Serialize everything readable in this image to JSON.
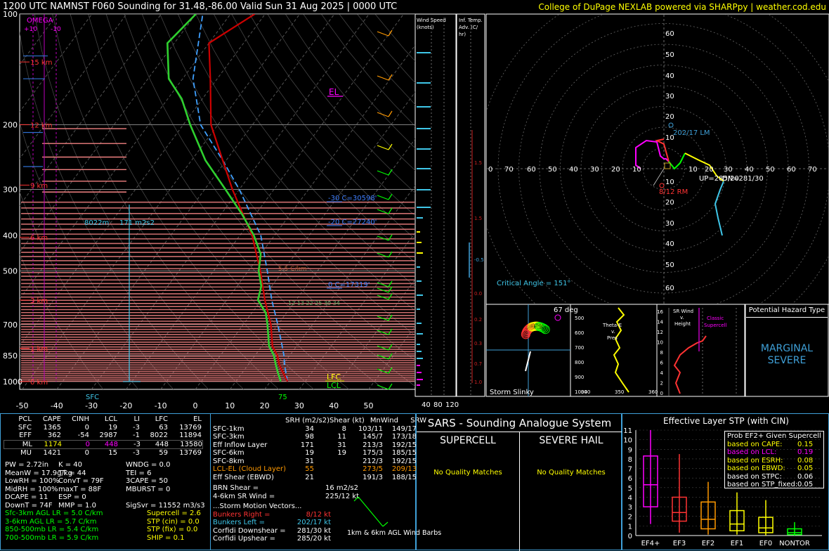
{
  "header": {
    "title": "1200 UTC NAMNST F060 Sounding for 31.48,-86.00 Valid  Sun 31 Aug 2025 | 0000 UTC",
    "credit": "College of DuPage NEXLAB powered via SHARPpy | weather.cod.edu"
  },
  "skewt": {
    "pressure_ticks": [
      "100",
      "200",
      "300",
      "400",
      "500",
      "700",
      "850",
      "1000"
    ],
    "temp_ticks": [
      "-50",
      "-40",
      "-30",
      "-20",
      "-10",
      "0",
      "10",
      "20",
      "30",
      "40",
      "50"
    ],
    "height_labels": [
      "15 km",
      "12 km",
      "9 km",
      "6 km",
      "3 km",
      "1 km",
      "0 km"
    ],
    "omega_label": "OMEGA",
    "omega_ticks": [
      "+10",
      "-10"
    ],
    "el_label": "EL",
    "lfc_label": "LFC",
    "lcl_label": "LCL",
    "sfc_label": "SFC",
    "sfc_temp": "75",
    "eff_layer_top": "8022m",
    "eff_layer_srh": "171 m2s2",
    "iso_labels": [
      "-30 C=30598'",
      "-20 C=27240'",
      "0 C=17319'"
    ],
    "lapse_label": "5.5 C/km",
    "dcape_labels": "12  13  22  25 30 34",
    "windspeed_title": "Wind Speed (knots)",
    "windspeed_ticks": [
      "40",
      "80",
      "120"
    ],
    "inf_temp_title": "Inf. Temp. Adv. (C/hr)",
    "inf_temp_ticks": [
      "1.5",
      "1.5",
      "-0.5",
      "0.0",
      "0.2",
      "0.3",
      "0.7",
      "1.0"
    ]
  },
  "hodograph": {
    "rings": [
      "60",
      "50",
      "40",
      "30",
      "20",
      "10"
    ],
    "x_labels": [
      "0",
      "70",
      "60",
      "50",
      "40",
      "30",
      "20",
      "10",
      "10",
      "20",
      "30",
      "40",
      "50",
      "60",
      "70"
    ],
    "lm_label": "202/17 LM",
    "rm_label": "8/12 RM",
    "up_label": "UP=285/20",
    "mw_label": "DN=281/30",
    "crit_angle": "Critical Angle = 151°"
  },
  "slinky": {
    "title": "Storm Slinky",
    "deg": "67 deg"
  },
  "theta": {
    "title": "Theta-E v. Pres",
    "ticks": [
      "500",
      "600",
      "700",
      "800",
      "900",
      "1000"
    ],
    "x_ticks": [
      "340",
      "350",
      "360"
    ]
  },
  "srwind": {
    "title": "SR Wind v. Height",
    "classic": "Classic Supercell",
    "ticks": [
      "16",
      "14",
      "12",
      "10",
      "8",
      "6",
      "4",
      "2",
      "0"
    ],
    "x_ticks": [
      "0",
      "60"
    ]
  },
  "hazard": {
    "title": "Potential Hazard Type",
    "value_line1": "MARGINAL",
    "value_line2": "SEVERE"
  },
  "parcels": {
    "headers": [
      "PCL",
      "CAPE",
      "CINH",
      "LCL",
      "LI",
      "LFC",
      "EL"
    ],
    "rows": [
      {
        "pcl": "SFC",
        "cape": "1365",
        "cinh": "0",
        "lcl": "19",
        "li": "-3",
        "lfc": "63",
        "el": "13769"
      },
      {
        "pcl": "EFF",
        "cape": "362",
        "cinh": "-54",
        "lcl": "2987",
        "li": "-1",
        "lfc": "8022",
        "el": "11894"
      },
      {
        "pcl": "ML",
        "cape": "1174",
        "cinh": "0",
        "lcl": "448",
        "li": "-3",
        "lfc": "448",
        "el": "13580"
      },
      {
        "pcl": "MU",
        "cape": "1421",
        "cinh": "0",
        "lcl": "15",
        "li": "-3",
        "lfc": "59",
        "el": "13769"
      }
    ]
  },
  "indices": {
    "col1": [
      "PW = 2.72in",
      "MeanW = 17.9g/kg",
      "LowRH = 100%",
      "MidRH = 100%",
      "DCAPE = 11",
      "DownT = 74F"
    ],
    "col2": [
      "K = 40",
      "TT = 44",
      "ConvT = 79F",
      "maxT = 88F",
      "ESP = 0",
      "MMP = 1.0"
    ],
    "col3": [
      "WNDG = 0.0",
      "TEI = 6",
      "3CAPE = 50",
      "MBURST = 0",
      "",
      "SigSvr = 11552 m3/s3"
    ]
  },
  "lapse": [
    "Sfc-3km AGL LR = 5.0 C/km",
    "3-6km AGL LR = 5.7 C/km",
    "850-500mb LR = 5.4 C/km",
    "700-500mb LR = 5.9 C/km"
  ],
  "composites": [
    "Supercell = 2.6",
    "STP (cin) = 0.0",
    "STP (fix) = 0.0",
    "SHIP = 0.1"
  ],
  "kinematics": {
    "headers": [
      "SRH (m2/s2)",
      "Shear (kt)",
      "MnWind",
      "SRW"
    ],
    "rows": [
      [
        "SFC-1km",
        "34",
        "8",
        "103/11",
        "149/17"
      ],
      [
        "SFC-3km",
        "98",
        "11",
        "145/7",
        "173/18"
      ],
      [
        "Eff Inflow Layer",
        "171",
        "31",
        "213/3",
        "192/15"
      ],
      [
        "",
        "",
        "",
        "",
        ""
      ],
      [
        "SFC-6km",
        "19",
        "19",
        "175/3",
        "185/15"
      ],
      [
        "SFC-8km",
        "31",
        "",
        "212/3",
        "192/15"
      ],
      [
        "LCL-EL (Cloud Layer)",
        "55",
        "",
        "273/5",
        "209/13"
      ],
      [
        "Eff Shear (EBWD)",
        "21",
        "",
        "191/3",
        "188/15"
      ]
    ],
    "brn_shear": "BRN Shear =",
    "brn_val": "16 m2/s2",
    "sr46": "4-6km SR Wind =",
    "sr46_val": "225/12 kt",
    "storm_motion_title": "...Storm Motion Vectors...",
    "motions": [
      [
        "Bunkers Right =",
        "8/12 kt"
      ],
      [
        "Bunkers Left =",
        "202/17 kt"
      ],
      [
        "Corfidi Downshear =",
        "281/30 kt"
      ],
      [
        "Corfidi Upshear =",
        "285/20 kt"
      ]
    ],
    "barb_label": "1km & 6km AGL Wind Barbs"
  },
  "sars": {
    "title": "SARS - Sounding Analogue System",
    "supercell": "SUPERCELL",
    "hail": "SEVERE HAIL",
    "sup_match": "No Quality Matches",
    "hail_match": "No Quality Matches"
  },
  "stp": {
    "title": "Effective Layer STP (with CIN)",
    "y_ticks": [
      "0",
      "1",
      "2",
      "3",
      "4",
      "5",
      "6",
      "7",
      "8",
      "9",
      "10",
      "11"
    ],
    "prob_title": "Prob EF2+ Given Supercell",
    "probs": [
      [
        "based on CAPE:",
        "0.15"
      ],
      [
        "based on LCL:",
        "0.19"
      ],
      [
        "based on ESRH:",
        "0.08"
      ],
      [
        "based on EBWD:",
        "0.05"
      ],
      [
        "based on STPC:",
        "0.06"
      ],
      [
        "based on STP_fixed:",
        "0.05"
      ]
    ]
  },
  "chart_data": {
    "type": "box",
    "title": "Effective Layer STP (with CIN)",
    "categories": [
      "EF4+",
      "EF3",
      "EF2",
      "EF1",
      "EF0",
      "NONTOR"
    ],
    "ylim": [
      0,
      11
    ],
    "boxes": [
      {
        "cat": "EF4+",
        "whisker_low": 1.2,
        "q1": 3.0,
        "median": 5.3,
        "q3": 8.3,
        "whisker_high": 11.0,
        "color": "#ff00ff"
      },
      {
        "cat": "EF3",
        "whisker_low": 0.3,
        "q1": 1.5,
        "median": 2.4,
        "q3": 4.0,
        "whisker_high": 8.5,
        "color": "#ff3333"
      },
      {
        "cat": "EF2",
        "whisker_low": 0.1,
        "q1": 0.7,
        "median": 1.7,
        "q3": 3.5,
        "whisker_high": 5.6,
        "color": "#ff9900"
      },
      {
        "cat": "EF1",
        "whisker_low": 0.1,
        "q1": 0.5,
        "median": 1.2,
        "q3": 2.6,
        "whisker_high": 4.5,
        "color": "#ffff00"
      },
      {
        "cat": "EF0",
        "whisker_low": 0.0,
        "q1": 0.3,
        "median": 0.8,
        "q3": 1.9,
        "whisker_high": 3.7,
        "color": "#ffff00"
      },
      {
        "cat": "NONTOR",
        "whisker_low": 0.0,
        "q1": 0.1,
        "median": 0.3,
        "q3": 0.7,
        "whisker_high": 1.4,
        "color": "#00ff00"
      }
    ]
  }
}
